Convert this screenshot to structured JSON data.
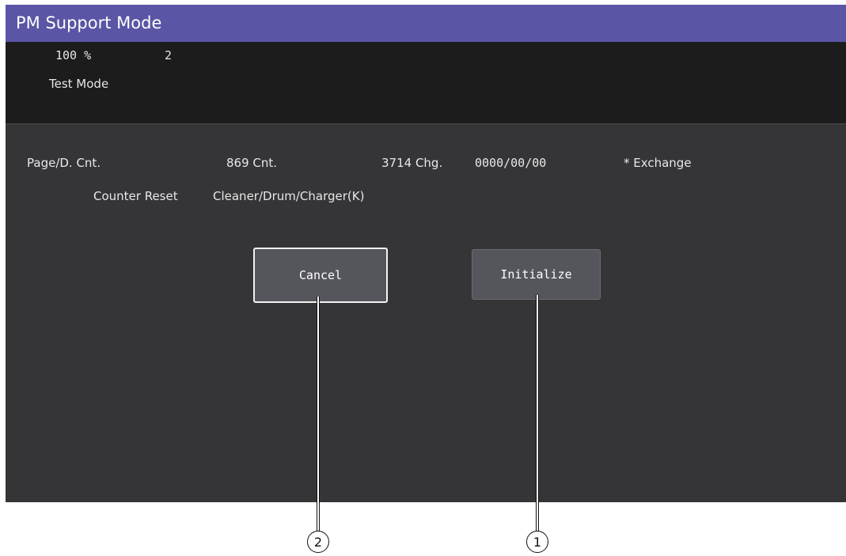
{
  "window": {
    "title": "PM Support Mode"
  },
  "status": {
    "zoom": "100 %",
    "copies": "2",
    "mode": "Test Mode"
  },
  "info": {
    "page_count_label": "Page/D. Cnt.",
    "count_value": "869 Cnt.",
    "change_value": "3714 Chg.",
    "date_value": "0000/00/00",
    "exchange_label": "* Exchange",
    "counter_reset_label": "Counter Reset",
    "part_name": "Cleaner/Drum/Charger(K)"
  },
  "buttons": {
    "cancel_label": "Cancel",
    "initialize_label": "Initialize"
  },
  "callouts": {
    "initialize": "1",
    "cancel": "2"
  }
}
